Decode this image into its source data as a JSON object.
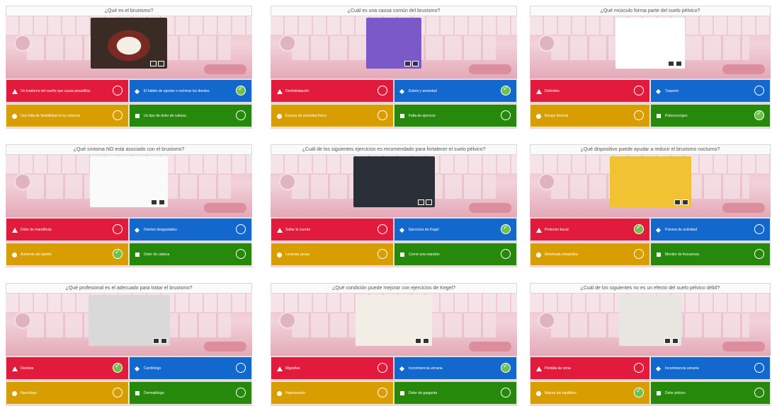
{
  "colors": {
    "red": "#e21b3c",
    "blue": "#1368ce",
    "yellow": "#d89e00",
    "green": "#26890c",
    "correct": "#6cc24a"
  },
  "cards": [
    {
      "question": "¿Qué es el bruxismo?",
      "image": "mouth-grinding-teeth",
      "answers": [
        {
          "text": "Un trastorno del sueño que causa pesadillas",
          "correct": false
        },
        {
          "text": "El hábito de apretar o rechinar los dientes",
          "correct": true
        },
        {
          "text": "Una falta de flexibilidad en la columna",
          "correct": false
        },
        {
          "text": "Un tipo de dolor de cabeza",
          "correct": false
        }
      ]
    },
    {
      "question": "¿Cuál es una causa común del bruxismo?",
      "image": "wind-up-teeth-toy",
      "answers": [
        {
          "text": "Deshidratación",
          "correct": false
        },
        {
          "text": "Estrés y ansiedad",
          "correct": true
        },
        {
          "text": "Exceso de actividad física",
          "correct": false
        },
        {
          "text": "Falta de ejercicio",
          "correct": false
        }
      ]
    },
    {
      "question": "¿Qué músculo forma parte del suelo pélvico?",
      "image": "pelvis-model",
      "answers": [
        {
          "text": "Deltoides",
          "correct": false
        },
        {
          "text": "Trapecio",
          "correct": false
        },
        {
          "text": "Bíceps femoral",
          "correct": false
        },
        {
          "text": "Pubococcígeo",
          "correct": true
        }
      ]
    },
    {
      "question": "¿Qué síntoma NO está asociado con el bruxismo?",
      "image": "question-marks",
      "answers": [
        {
          "text": "Dolor de mandíbula",
          "correct": false
        },
        {
          "text": "Dientes desgastados",
          "correct": false
        },
        {
          "text": "Aumento del apetito",
          "correct": true
        },
        {
          "text": "Dolor de cabeza",
          "correct": false
        }
      ]
    },
    {
      "question": "¿Cuál de los siguientes ejercicios es recomendado para fortalecer el suelo pélvico?",
      "image": "gym-dumbbell",
      "answers": [
        {
          "text": "Saltar la cuerda",
          "correct": false
        },
        {
          "text": "Ejercicios de Kegel",
          "correct": true
        },
        {
          "text": "Levantar pesas",
          "correct": false
        },
        {
          "text": "Correr una maratón",
          "correct": false
        }
      ]
    },
    {
      "question": "¿Qué dispositivo puede ayudar a reducir el bruxismo nocturno?",
      "image": "smile-mouthguard",
      "answers": [
        {
          "text": "Protector bucal",
          "correct": true
        },
        {
          "text": "Pulsera de actividad",
          "correct": false
        },
        {
          "text": "Almohada ortopédica",
          "correct": false
        },
        {
          "text": "Monitor de frecuencia",
          "correct": false
        }
      ]
    },
    {
      "question": "¿Qué profesional es el adecuado para tratar el bruxismo?",
      "image": "doctors",
      "answers": [
        {
          "text": "Dentista",
          "correct": true
        },
        {
          "text": "Cardiólogo",
          "correct": false
        },
        {
          "text": "Neurólogo",
          "correct": false
        },
        {
          "text": "Dermatólogo",
          "correct": false
        }
      ]
    },
    {
      "question": "¿Qué condición puede mejorar con ejercicios de Kegel?",
      "image": "floor-exercise",
      "answers": [
        {
          "text": "Migrañas",
          "correct": false
        },
        {
          "text": "Incontinencia urinaria",
          "correct": true
        },
        {
          "text": "Hipertensión",
          "correct": false
        },
        {
          "text": "Dolor de garganta",
          "correct": false
        }
      ]
    },
    {
      "question": "¿Cuál de los siguientes no es un efecto del suelo pélvico débil?",
      "image": "woman-core",
      "answers": [
        {
          "text": "Pérdida de orina",
          "correct": false
        },
        {
          "text": "Incontinencia urinaria",
          "correct": false
        },
        {
          "text": "Mejora del equilibrio",
          "correct": true
        },
        {
          "text": "Dolor pélvico",
          "correct": false
        }
      ]
    }
  ]
}
